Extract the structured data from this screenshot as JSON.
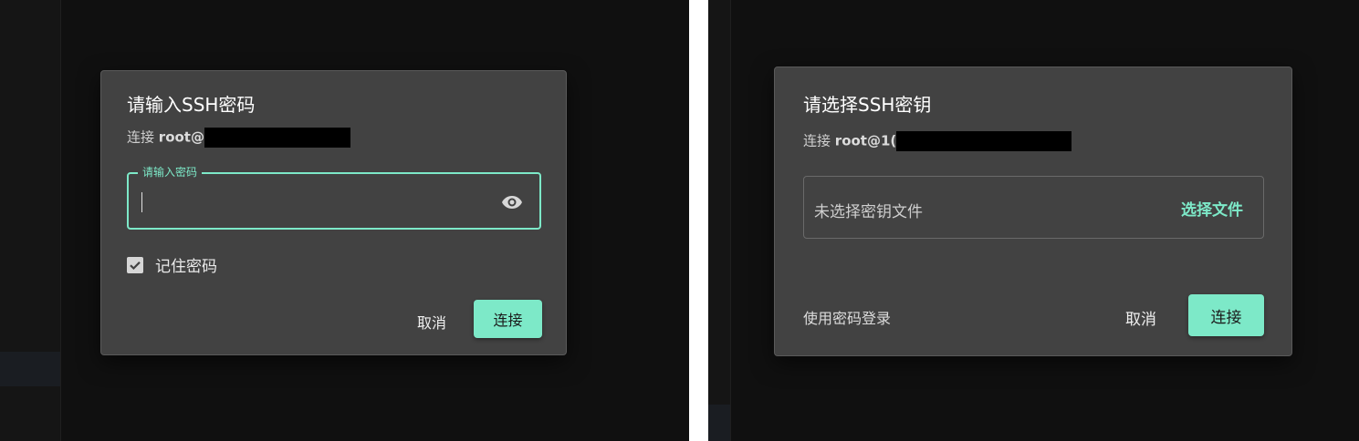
{
  "password_dialog": {
    "title": "请输入SSH密码",
    "subtitle_prefix": "连接",
    "host_visible": "root@",
    "password_field": {
      "label": "请输入密码",
      "value": ""
    },
    "remember": {
      "label": "记住密码",
      "checked": true
    },
    "cancel_label": "取消",
    "connect_label": "连接"
  },
  "key_dialog": {
    "title": "请选择SSH密钥",
    "subtitle_prefix": "连接",
    "host_visible": "root@1(",
    "file_status": "未选择密钥文件",
    "choose_file_label": "选择文件",
    "use_password_label": "使用密码登录",
    "cancel_label": "取消",
    "connect_label": "连接"
  },
  "colors": {
    "accent": "#7de9c8",
    "dialog_bg": "#424242",
    "backdrop": "#101010"
  },
  "icons": {
    "visibility": "eye-icon",
    "checkbox": "check-icon"
  }
}
